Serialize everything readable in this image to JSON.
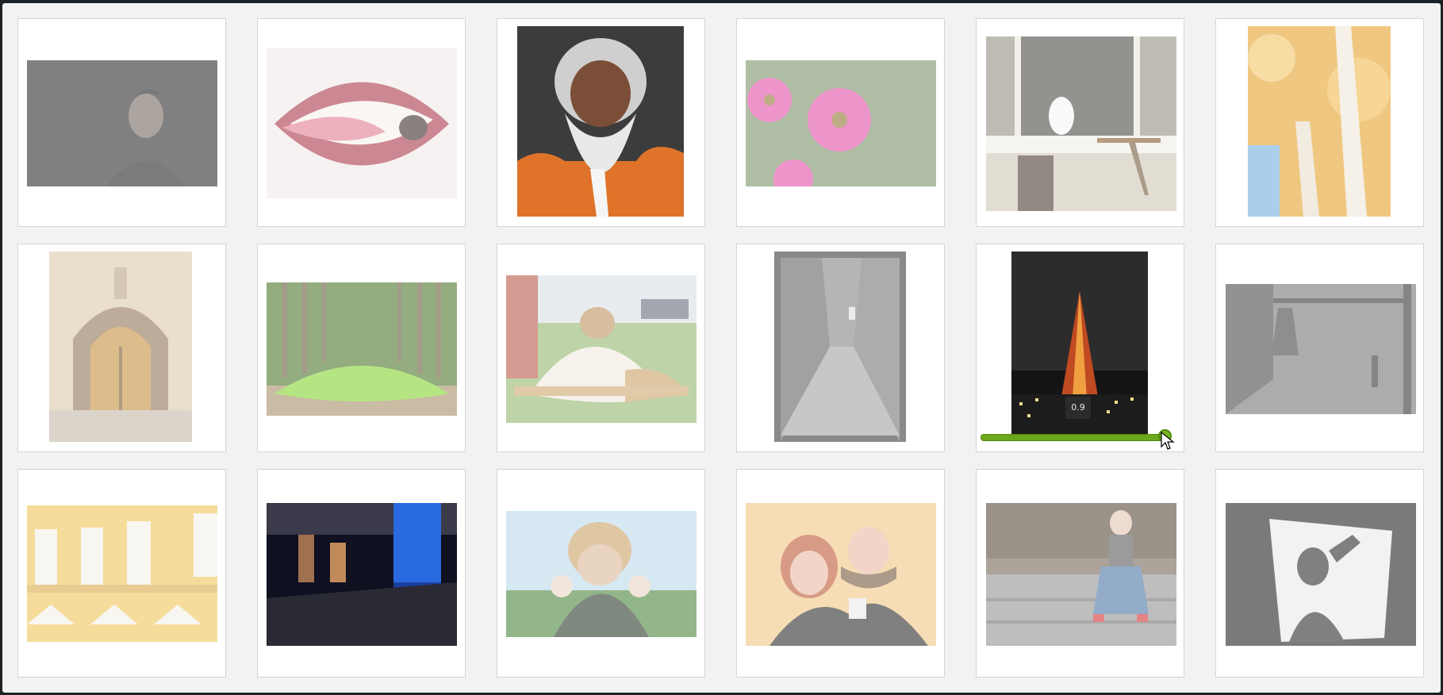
{
  "gallery": {
    "items": [
      {
        "name": "photo-man-dark"
      },
      {
        "name": "photo-lips-glitter"
      },
      {
        "name": "photo-bearded-man"
      },
      {
        "name": "photo-pink-flowers"
      },
      {
        "name": "photo-cat-window"
      },
      {
        "name": "photo-autumn-birch"
      },
      {
        "name": "photo-arched-door"
      },
      {
        "name": "photo-green-canal"
      },
      {
        "name": "photo-shih-tzu"
      },
      {
        "name": "photo-cobblestone-alley"
      },
      {
        "name": "photo-tokyo-tower"
      },
      {
        "name": "photo-street-lamp"
      },
      {
        "name": "photo-yellow-building"
      },
      {
        "name": "photo-blue-interior"
      },
      {
        "name": "photo-boy-covering-face"
      },
      {
        "name": "photo-couple-hug"
      },
      {
        "name": "photo-man-on-stoop"
      },
      {
        "name": "photo-shadow-screen"
      }
    ]
  },
  "opacity_slider": {
    "value_label": "0.9",
    "value": 0.9,
    "track_color": "#6ba81b"
  }
}
